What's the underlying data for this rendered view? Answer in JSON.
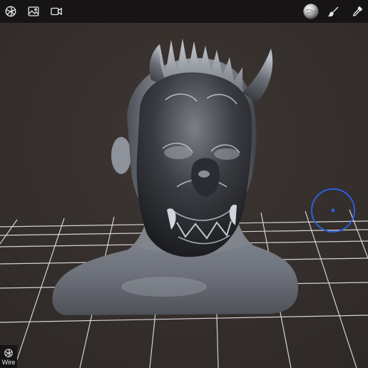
{
  "toolbar": {
    "left_icons": [
      "scene-icon",
      "image-icon",
      "video-camera-icon"
    ],
    "right_icons": [
      "matcap-sphere-icon",
      "brush-icon",
      "eyedropper-icon"
    ]
  },
  "viewport": {
    "background": "#38322f",
    "grid_color": "#e6e6e6",
    "gizmo_color": "#2c5fe0"
  },
  "wire": {
    "label": "Wire",
    "icon": "wireframe-icon"
  }
}
